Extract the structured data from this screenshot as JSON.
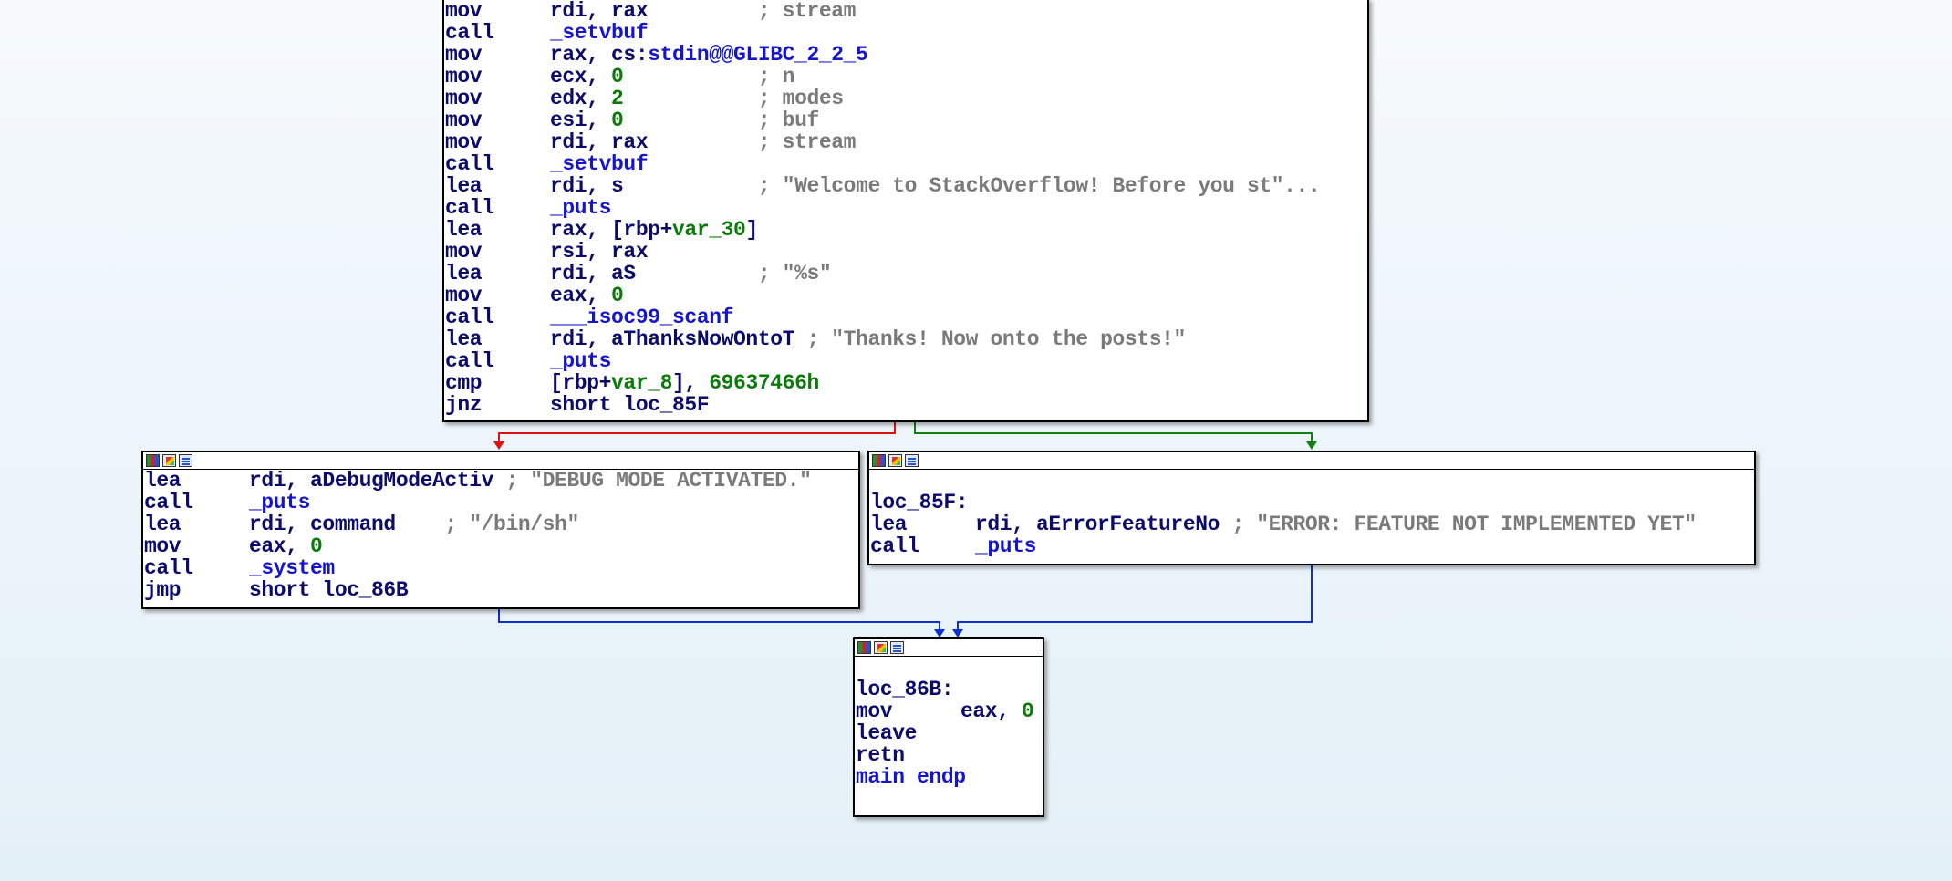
{
  "top_block": {
    "lines": [
      {
        "mn": "mov",
        "op": "rdi, rax",
        "pad": "         ",
        "cmt": "; stream"
      },
      {
        "mn": "call",
        "op": "",
        "name": "_setvbuf"
      },
      {
        "mn": "mov",
        "op": "rax, cs:",
        "name": "stdin@@GLIBC_2_2_5"
      },
      {
        "mn": "mov",
        "op": "ecx, ",
        "num": "0",
        "pad": "           ",
        "cmt": "; n"
      },
      {
        "mn": "mov",
        "op": "edx, ",
        "num": "2",
        "pad": "           ",
        "cmt": "; modes"
      },
      {
        "mn": "mov",
        "op": "esi, ",
        "num": "0",
        "pad": "           ",
        "cmt": "; buf"
      },
      {
        "mn": "mov",
        "op": "rdi, rax",
        "pad": "         ",
        "cmt": "; stream"
      },
      {
        "mn": "call",
        "op": "",
        "name": "_setvbuf"
      },
      {
        "mn": "lea",
        "op": "rdi, s",
        "pad": "           ",
        "cmt": "; \"Welcome to StackOverflow! Before you st\"..."
      },
      {
        "mn": "call",
        "op": "",
        "name": "_puts"
      },
      {
        "mn": "lea",
        "op": "rax, [rbp+",
        "num": "var_30",
        "after": "]"
      },
      {
        "mn": "mov",
        "op": "rsi, rax"
      },
      {
        "mn": "lea",
        "op": "rdi, aS",
        "pad": "          ",
        "cmt": "; \"%s\""
      },
      {
        "mn": "mov",
        "op": "eax, ",
        "num": "0"
      },
      {
        "mn": "call",
        "op": "",
        "name": "___isoc99_scanf"
      },
      {
        "mn": "lea",
        "op": "rdi, aThanksNowOntoT ",
        "cmt": "; \"Thanks! Now onto the posts!\""
      },
      {
        "mn": "call",
        "op": "",
        "name": "_puts"
      },
      {
        "mn": "cmp",
        "op": "[rbp+",
        "num": "var_8",
        "after": "], ",
        "num2": "69637466h"
      },
      {
        "mn": "jnz",
        "op": "short loc_85F"
      }
    ]
  },
  "left_block": {
    "lines": [
      {
        "mn": "lea",
        "op": "rdi, aDebugModeActiv ",
        "cmt": "; \"DEBUG MODE ACTIVATED.\""
      },
      {
        "mn": "call",
        "op": "",
        "name": "_puts"
      },
      {
        "mn": "lea",
        "op": "rdi, command",
        "pad": "    ",
        "cmt": "; \"/bin/sh\""
      },
      {
        "mn": "mov",
        "op": "eax, ",
        "num": "0"
      },
      {
        "mn": "call",
        "op": "",
        "name": "_system"
      },
      {
        "mn": "jmp",
        "op": "short loc_86B"
      }
    ]
  },
  "right_block": {
    "label": "loc_85F:",
    "lines": [
      {
        "mn": "lea",
        "op": "rdi, aErrorFeatureNo ",
        "cmt": "; \"ERROR: FEATURE NOT IMPLEMENTED YET\""
      },
      {
        "mn": "call",
        "op": "",
        "name": "_puts"
      }
    ]
  },
  "bottom_block": {
    "label": "loc_86B:",
    "lines": [
      {
        "mn": "mov",
        "op": "eax, ",
        "num": "0"
      },
      {
        "mn": "leave",
        "op": ""
      },
      {
        "mn": "retn",
        "op": ""
      }
    ],
    "footer": "main endp"
  },
  "colors": {
    "mnemonic": "#0b0b6b",
    "name": "#1515d0",
    "number": "#0a7a0a",
    "comment": "#7a7a7a",
    "edge_false": "#e01010",
    "edge_true": "#108010",
    "edge_jump": "#1030d0"
  }
}
